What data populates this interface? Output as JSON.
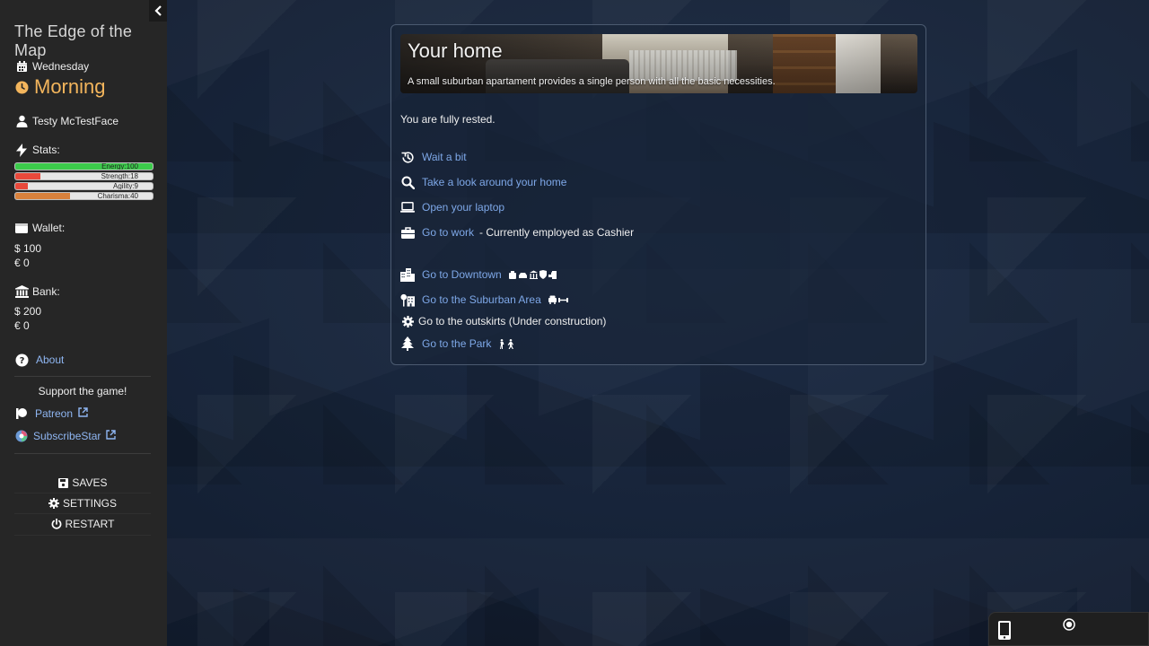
{
  "sidebar": {
    "game_title": "The Edge of the Map",
    "day": "Wednesday",
    "time_of_day": "Morning",
    "player_name": "Testy McTestFace",
    "stats_label": "Stats:",
    "stats": [
      {
        "label": "Energy:100",
        "value": 100,
        "max": 100,
        "color": "#3ccb4b"
      },
      {
        "label": "Strength:18",
        "value": 18,
        "max": 100,
        "color": "#e8493b"
      },
      {
        "label": "Agility:9",
        "value": 9,
        "max": 100,
        "color": "#e8493b"
      },
      {
        "label": "Charisma:40",
        "value": 40,
        "max": 100,
        "color": "#d9813c"
      }
    ],
    "wallet_label": "Wallet:",
    "wallet_usd": "$ 100",
    "wallet_eur": "€ 0",
    "bank_label": "Bank:",
    "bank_usd": "$ 200",
    "bank_eur": "€ 0",
    "about_label": "About",
    "support_text": "Support the game!",
    "patreon_label": "Patreon",
    "subscribestar_label": "SubscribeStar",
    "menu": {
      "saves": "SAVES",
      "settings": "SETTINGS",
      "restart": "RESTART"
    }
  },
  "location": {
    "title": "Your home",
    "description": "A small suburban apartament provides a single person with all the basic necessities.",
    "status": "You are fully rested.",
    "actions": [
      {
        "label": "Wait a bit",
        "icon": "history-icon"
      },
      {
        "label": "Take a look around your home",
        "icon": "search-icon"
      },
      {
        "label": "Open your laptop",
        "icon": "laptop-icon"
      },
      {
        "label": "Go to work",
        "icon": "briefcase-icon",
        "suffix": "- Currently employed as Cashier"
      }
    ],
    "travel": [
      {
        "label": "Go to Downtown",
        "icon": "city-icon"
      },
      {
        "label": "Go to the Suburban Area",
        "icon": "suburb-icon"
      },
      {
        "label": "Go to the outskirts (Under construction)",
        "icon": "gear-icon"
      },
      {
        "label": "Go to the Park",
        "icon": "tree-icon"
      }
    ]
  },
  "colors": {
    "link": "#7ea8e8",
    "accent_time": "#f3b55c",
    "sidebar_bg": "#262626"
  }
}
